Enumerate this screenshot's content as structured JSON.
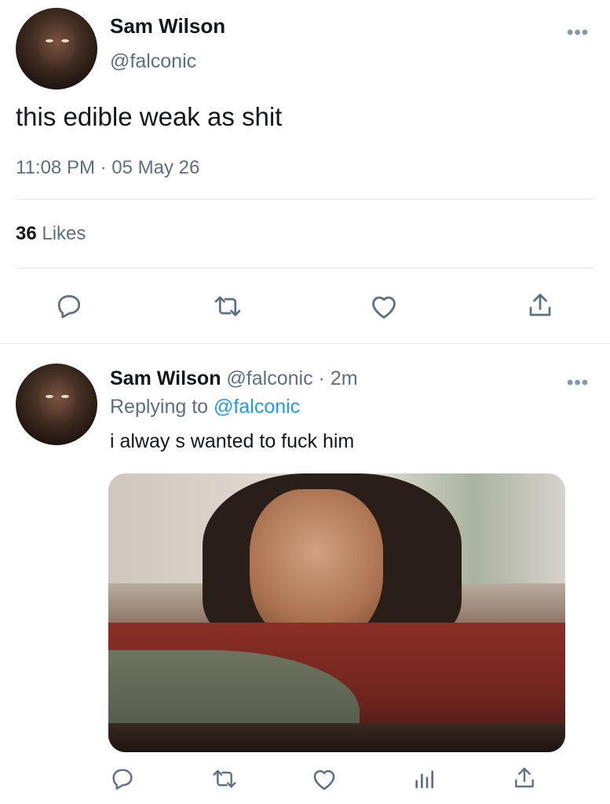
{
  "main_tweet": {
    "name": "Sam Wilson",
    "handle": "@falconic",
    "text": "this edible weak as shit",
    "timestamp": "11:08 PM · 05 May 26",
    "likes_count": "36",
    "likes_label": "Likes",
    "more": "•••"
  },
  "reply_tweet": {
    "name": "Sam Wilson",
    "handle": "@falconic",
    "sep": "·",
    "time": "2m",
    "replying_prefix": "Replying to",
    "replying_handle": "@falconic",
    "text": "i alway s wanted to fuck him",
    "more": "•••"
  },
  "icons": {
    "reply": "reply-icon",
    "retweet": "retweet-icon",
    "like": "heart-icon",
    "share": "share-icon",
    "analytics": "analytics-icon"
  },
  "colors": {
    "text": "#14171a",
    "secondary": "#5b7083",
    "link": "#1d9bf0",
    "divider": "#e1e8ed"
  }
}
